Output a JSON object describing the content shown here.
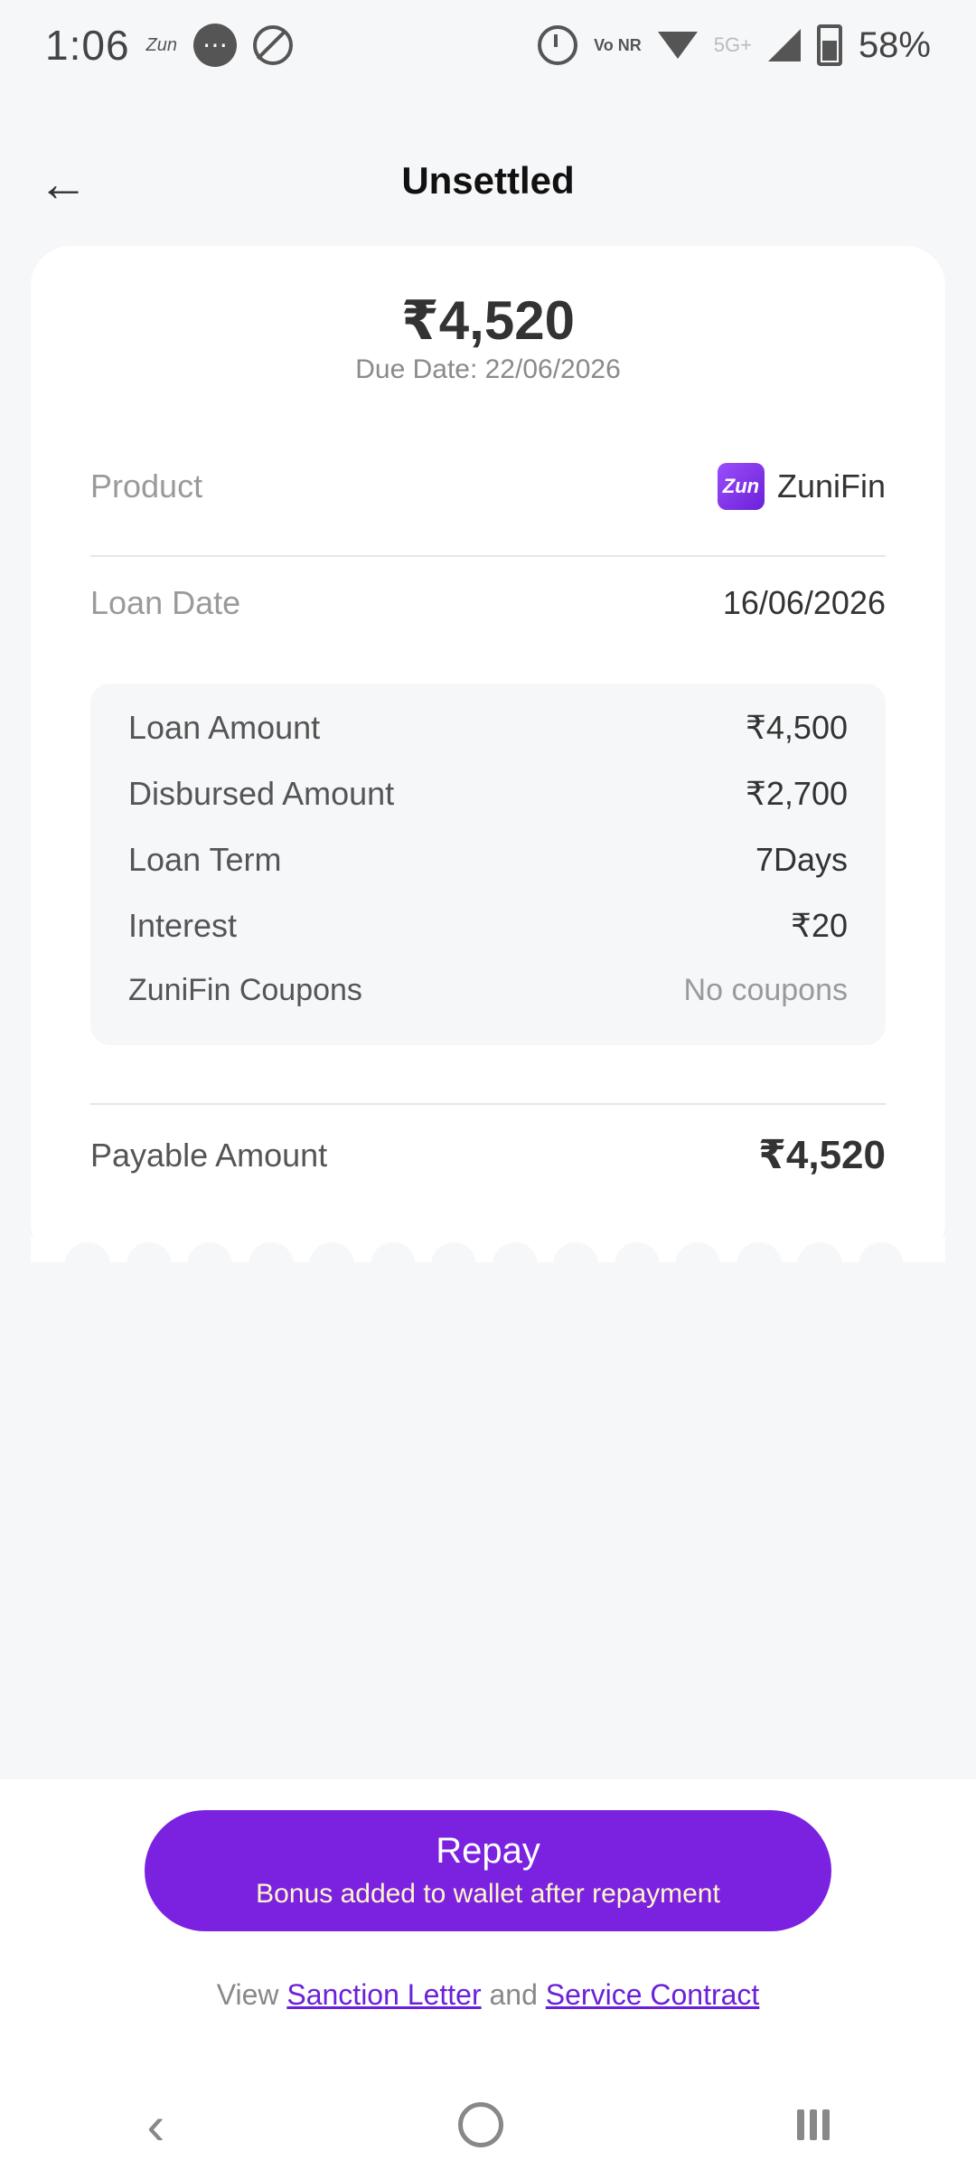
{
  "status_bar": {
    "time": "1:06",
    "brand_small": "Zun",
    "battery": "58%",
    "network_type": "5G+",
    "volte": "Vo NR"
  },
  "header": {
    "title": "Unsettled"
  },
  "card": {
    "amount": "₹4,520",
    "due_date": "Due Date: 22/06/2026",
    "product": {
      "label": "Product",
      "brand_logo_text": "Zun",
      "value": "ZuniFin"
    },
    "loan_date": {
      "label": "Loan Date",
      "value": "16/06/2026"
    },
    "details": [
      {
        "label": "Loan Amount",
        "value": "₹4,500"
      },
      {
        "label": "Disbursed Amount",
        "value": "₹2,700"
      },
      {
        "label": "Loan Term",
        "value": "7Days"
      },
      {
        "label": "Interest",
        "value": "₹20"
      },
      {
        "label": "ZuniFin Coupons",
        "value": "No coupons"
      }
    ],
    "payable": {
      "label": "Payable Amount",
      "value": "₹4,520"
    }
  },
  "actions": {
    "repay_label": "Repay",
    "repay_sub": "Bonus added to wallet after repayment",
    "view_prefix": "View",
    "sanction_letter": "Sanction Letter",
    "and_text": "and",
    "service_contract": "Service Contract"
  },
  "colors": {
    "accent": "#7b22e0",
    "background": "#f6f7f9",
    "subtext": "#fff6c9"
  }
}
